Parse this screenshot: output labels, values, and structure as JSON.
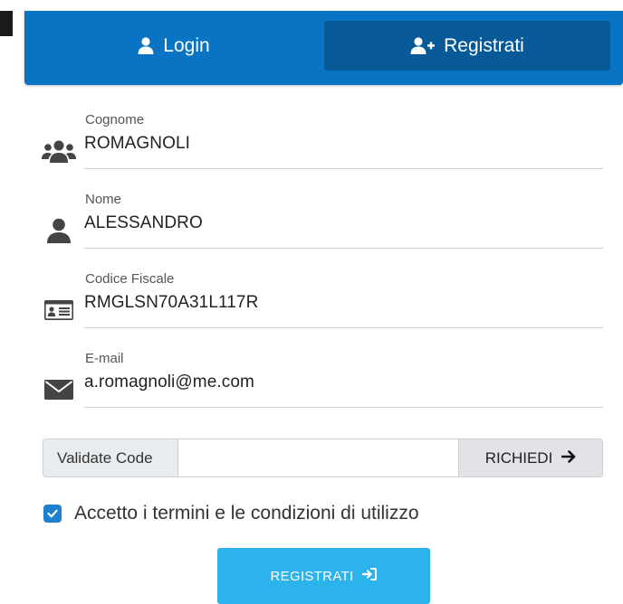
{
  "colors": {
    "header_bg": "#0a74c4",
    "active_tab_bg": "#075a97",
    "checkbox": "#1f7fd1",
    "submit_bg": "#2db3ec"
  },
  "tabs": {
    "login": {
      "label": "Login",
      "icon": "user-icon"
    },
    "register": {
      "label": "Registrati",
      "icon": "user-plus-icon",
      "active": true
    }
  },
  "form": {
    "fields": [
      {
        "label": "Cognome",
        "value": "ROMAGNOLI",
        "icon": "users-icon"
      },
      {
        "label": "Nome",
        "value": "ALESSANDRO",
        "icon": "user-icon"
      },
      {
        "label": "Codice Fiscale",
        "value": "RMGLSN70A31L117R",
        "icon": "id-card-icon"
      },
      {
        "label": "E-mail",
        "value": "a.romagnoli@me.com",
        "icon": "envelope-icon"
      }
    ],
    "validate": {
      "label": "Validate Code",
      "value": "",
      "button_label": "RICHIEDI",
      "button_icon": "arrow-right-icon"
    },
    "terms": {
      "checked": true,
      "text": "Accetto i termini e le condizioni di utilizzo"
    },
    "submit": {
      "label": "REGISTRATI",
      "icon": "sign-in-icon"
    }
  }
}
